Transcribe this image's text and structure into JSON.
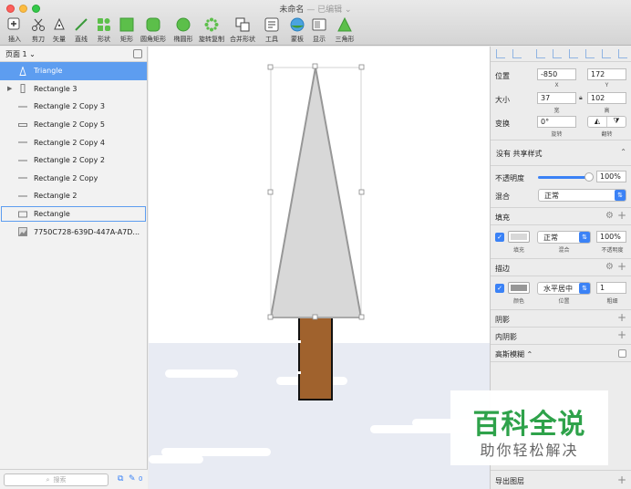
{
  "window": {
    "title": "未命名",
    "edited": "— 已编辑 ⌄"
  },
  "toolbar": [
    {
      "name": "insert",
      "label": "插入",
      "icon": "plus-icon"
    },
    {
      "name": "scissors",
      "label": "剪刀",
      "icon": "scissors-icon"
    },
    {
      "name": "vector",
      "label": "矢量",
      "icon": "pen-icon"
    },
    {
      "name": "line",
      "label": "直线",
      "icon": "line-icon"
    },
    {
      "name": "shape",
      "label": "形状",
      "icon": "shapes-icon"
    },
    {
      "name": "rectangle",
      "label": "矩形",
      "icon": "rectangle-icon"
    },
    {
      "name": "rounded-rect",
      "label": "圆角矩形",
      "icon": "rounded-rect-icon"
    },
    {
      "name": "oval",
      "label": "椭圆形",
      "icon": "oval-icon"
    },
    {
      "name": "rotate-copy",
      "label": "旋转复制",
      "icon": "rotate-copy-icon"
    },
    {
      "name": "combine",
      "label": "合并形状",
      "icon": "combine-icon"
    },
    {
      "name": "tools",
      "label": "工具",
      "icon": "tools-icon"
    },
    {
      "name": "artboard",
      "label": "蒙板",
      "icon": "mask-icon"
    },
    {
      "name": "view",
      "label": "显示",
      "icon": "view-icon"
    },
    {
      "name": "triangle",
      "label": "三角形",
      "icon": "triangle-icon"
    }
  ],
  "pages": {
    "label": "页面 1 ⌄"
  },
  "layers": [
    {
      "name": "Triangle",
      "icon": "triangle-outline-icon",
      "state": "selected"
    },
    {
      "name": "Rectangle 3",
      "icon": "rect-vertical-icon",
      "state": "group"
    },
    {
      "name": "Rectangle 2 Copy 3",
      "icon": "line-icon",
      "state": ""
    },
    {
      "name": "Rectangle 2 Copy 5",
      "icon": "rect-thin-icon",
      "state": ""
    },
    {
      "name": "Rectangle 2 Copy 4",
      "icon": "line-icon",
      "state": ""
    },
    {
      "name": "Rectangle 2 Copy 2",
      "icon": "line-icon",
      "state": ""
    },
    {
      "name": "Rectangle 2 Copy",
      "icon": "line-icon",
      "state": ""
    },
    {
      "name": "Rectangle 2",
      "icon": "line-icon",
      "state": ""
    },
    {
      "name": "Rectangle",
      "icon": "rect-icon",
      "state": "outlined"
    },
    {
      "name": "7750C728-639D-447A-A7D...",
      "icon": "image-icon",
      "state": ""
    }
  ],
  "left_footer": {
    "search_placeholder": "搜索",
    "count": "0"
  },
  "inspector": {
    "position": {
      "label": "位置",
      "x": "-850",
      "y": "172",
      "x_label": "X",
      "y_label": "Y"
    },
    "size": {
      "label": "大小",
      "w": "37",
      "h": "102",
      "w_label": "宽",
      "h_label": "高"
    },
    "transform": {
      "label": "变换",
      "rotation": "0°",
      "rotation_label": "旋转",
      "flip_label": "翻转"
    },
    "shared_style": "没有 共享样式",
    "opacity": {
      "label": "不透明度",
      "value": "100%",
      "fraction": 1.0
    },
    "blend": {
      "label": "混合",
      "value": "正常"
    },
    "fill": {
      "title": "填充",
      "blend": "正常",
      "opacity": "100%",
      "fill_label": "填充",
      "blend_label": "混合",
      "opacity_label": "不透明度",
      "color": "#d8d8d8"
    },
    "border": {
      "title": "描边",
      "position": "水平居中",
      "width": "1",
      "color_label": "颜色",
      "position_label": "位置",
      "width_label": "粗细",
      "color": "#979797"
    },
    "shadow": "阴影",
    "inner_shadow": "内阴影",
    "gaussian": "高斯模糊 ⌃",
    "export": "导出图层"
  },
  "watermark": {
    "main": "百科全说",
    "sub": "助你轻松解决"
  },
  "colors": {
    "accent": "#5d9df0",
    "trunk": "#a0622d",
    "snow": "#e8ebf3",
    "tree": "#d8d8d8"
  }
}
